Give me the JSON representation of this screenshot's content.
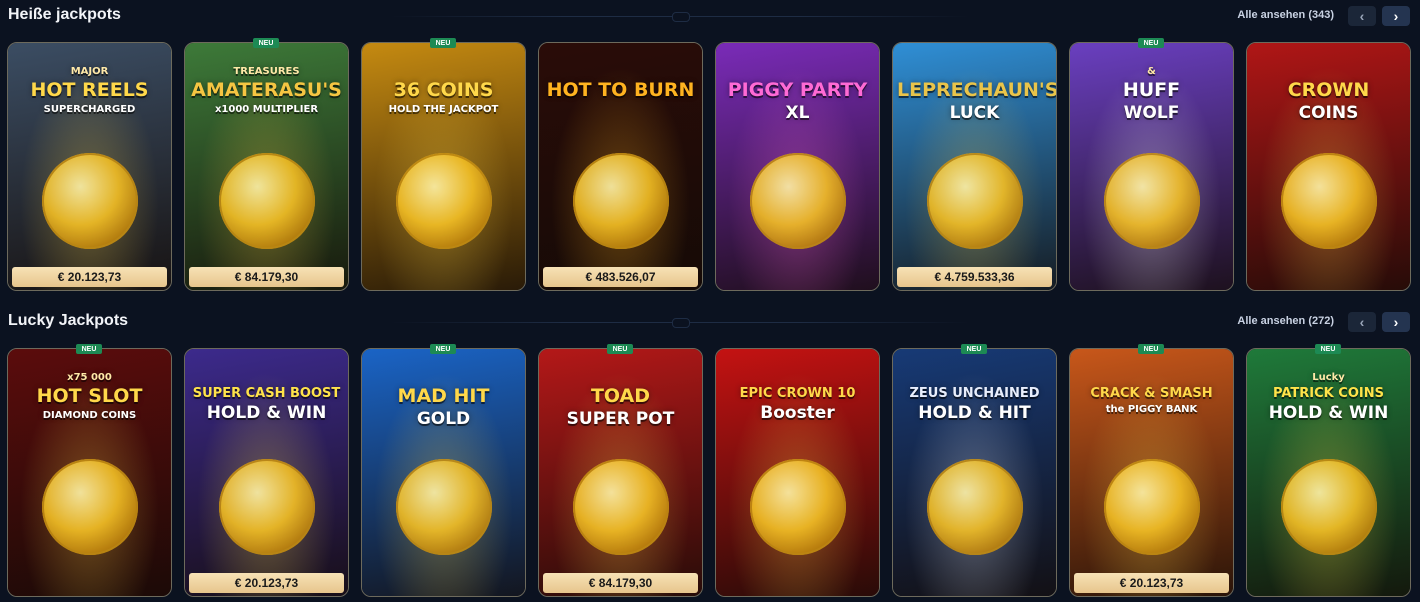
{
  "sections": [
    {
      "title": "Heiße jackpots",
      "view_all": "Alle ansehen (343)",
      "prev_label": "‹",
      "next_label": "›",
      "games": [
        {
          "title": "HOT REELS",
          "subtitle": "SUPERCHARGED",
          "extra": "MAJOR",
          "price": "€ 20.123,73",
          "is_new": false,
          "bg": "#3b4d63",
          "accent": "#ffd84a"
        },
        {
          "title": "AMATERASU'S",
          "subtitle": "x1000 MULTIPLIER",
          "extra": "TREASURES",
          "price": "€ 84.179,30",
          "is_new": true,
          "new_label": "NEU",
          "bg": "#3d7a39",
          "accent": "#f5c542"
        },
        {
          "title": "36 COINS",
          "subtitle": "HOLD THE JACKPOT",
          "extra": "",
          "price": "",
          "is_new": true,
          "new_label": "NEU",
          "bg": "#c58a11",
          "accent": "#ffd84a"
        },
        {
          "title": "HOT TO BURN",
          "subtitle": "",
          "extra": "",
          "price": "€ 483.526,07",
          "is_new": false,
          "bg": "#2a0c08",
          "accent": "#ffb320"
        },
        {
          "title": "PIGGY PARTY",
          "subtitle": "XL",
          "extra": "",
          "price": "",
          "is_new": false,
          "bg": "#7a2bb8",
          "accent": "#ff6ad5"
        },
        {
          "title": "LEPRECHAUN'S",
          "subtitle": "LUCK",
          "extra": "",
          "price": "€ 4.759.533,36",
          "is_new": false,
          "bg": "#2f8fd6",
          "accent": "#e9c44a"
        },
        {
          "title": "HUFF",
          "subtitle": "WOLF",
          "extra": "&",
          "price": "",
          "is_new": true,
          "new_label": "NEU",
          "bg": "#6a3fc0",
          "accent": "#ffffff"
        },
        {
          "title": "CROWN",
          "subtitle": "COINS",
          "extra": "",
          "price": "",
          "is_new": false,
          "bg": "#b01616",
          "accent": "#ffd84a"
        }
      ]
    },
    {
      "title": "Lucky Jackpots",
      "view_all": "Alle ansehen (272)",
      "prev_label": "‹",
      "next_label": "›",
      "games": [
        {
          "title": "HOT SLOT",
          "subtitle": "DIAMOND COINS",
          "extra": "x75 000",
          "price": "",
          "is_new": true,
          "new_label": "NEU",
          "bg": "#5b0c0c",
          "accent": "#ffd84a"
        },
        {
          "title": "SUPER CASH BOOST",
          "subtitle": "HOLD & WIN",
          "extra": "",
          "price": "€ 20.123,73",
          "is_new": false,
          "bg": "#3c2a8c",
          "accent": "#ffe34a"
        },
        {
          "title": "MAD HIT",
          "subtitle": "GOLD",
          "extra": "",
          "price": "",
          "is_new": true,
          "new_label": "NEU",
          "bg": "#1a64c6",
          "accent": "#ffd84a"
        },
        {
          "title": "TOAD",
          "subtitle": "SUPER POT",
          "extra": "",
          "price": "€ 84.179,30",
          "is_new": true,
          "new_label": "NEU",
          "bg": "#b41818",
          "accent": "#ffd84a"
        },
        {
          "title": "EPIC CROWN 10",
          "subtitle": "Booster",
          "extra": "",
          "price": "",
          "is_new": false,
          "bg": "#c41212",
          "accent": "#ffd84a"
        },
        {
          "title": "ZEUS UNCHAINED",
          "subtitle": "HOLD & HIT",
          "extra": "",
          "price": "",
          "is_new": true,
          "new_label": "NEU",
          "bg": "#173a76",
          "accent": "#e8eefc"
        },
        {
          "title": "CRACK & SMASH",
          "subtitle": "the PIGGY BANK",
          "extra": "",
          "price": "€ 20.123,73",
          "is_new": true,
          "new_label": "NEU",
          "bg": "#c8571a",
          "accent": "#ffd84a"
        },
        {
          "title": "PATRICK COINS",
          "subtitle": "HOLD & WIN",
          "extra": "Lucky",
          "price": "",
          "is_new": true,
          "new_label": "NEU",
          "bg": "#1f7a3a",
          "accent": "#ffe34a"
        }
      ]
    }
  ],
  "colors": {
    "background": "#0b1220",
    "price_bar": "#f2d9a8",
    "new_badge": "#1d8a54"
  }
}
